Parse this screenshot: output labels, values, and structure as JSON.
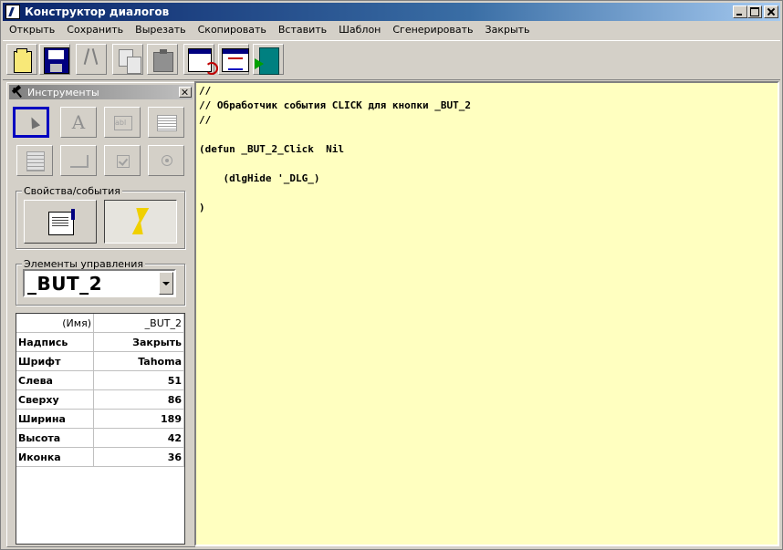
{
  "window": {
    "title": "Конструктор диалогов"
  },
  "menu": [
    "Открыть",
    "Сохранить",
    "Вырезать",
    "Скопировать",
    "Вставить",
    "Шаблон",
    "Сгенерировать",
    "Закрыть"
  ],
  "toolbar": {
    "icons": [
      "open-icon",
      "save-icon",
      "cut-icon",
      "copy-icon",
      "paste-icon",
      "template-icon",
      "generate-icon",
      "exit-icon"
    ]
  },
  "tools_panel": {
    "title": "Инструменты",
    "label_glyph": "A",
    "editbox_glyph": "abl"
  },
  "props_events": {
    "label": "Свойства/события",
    "active": "events"
  },
  "controls": {
    "label": "Элементы управления",
    "selected": "_BUT_2"
  },
  "properties": [
    {
      "key": "(Имя)",
      "value": "_BUT_2"
    },
    {
      "key": "Надпись",
      "value": "Закрыть"
    },
    {
      "key": "Шрифт",
      "value": "Tahoma"
    },
    {
      "key": "Слева",
      "value": "51"
    },
    {
      "key": "Сверху",
      "value": "86"
    },
    {
      "key": "Ширина",
      "value": "189"
    },
    {
      "key": "Высота",
      "value": "42"
    },
    {
      "key": "Иконка",
      "value": "36"
    }
  ],
  "code": [
    "//",
    "// Обработчик события CLICK для кнопки _BUT_2",
    "//",
    "",
    "(defun _BUT_2_Click  Nil",
    "",
    "    (dlgHide '_DLG_)",
    "",
    ")"
  ],
  "colors": {
    "editor_bg": "#ffffc0",
    "title_active": "#0a246a",
    "selection": "#0000c0"
  }
}
